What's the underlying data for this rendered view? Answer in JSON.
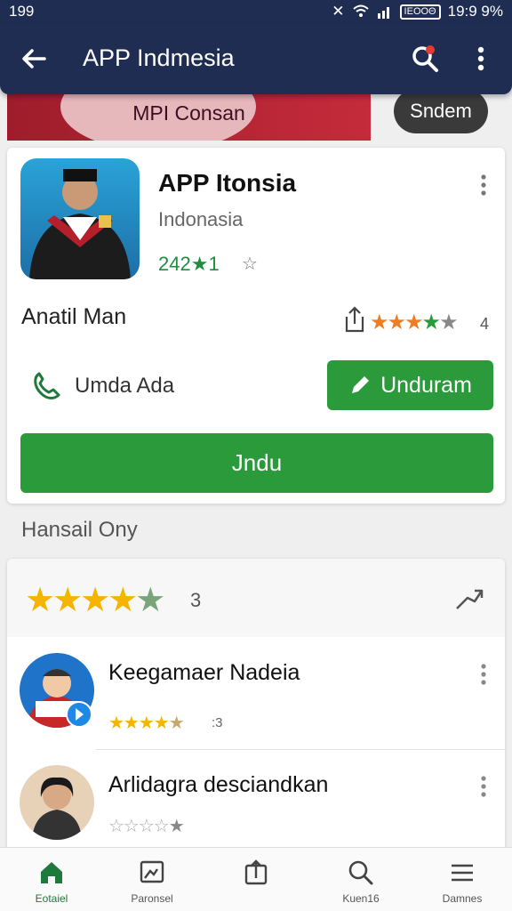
{
  "status": {
    "time_left": "199",
    "battery": "ΙΕΟΟΘ",
    "time_right": "19:9 9%"
  },
  "appbar": {
    "title": "APP Indmesia"
  },
  "banner": {
    "label": "MPI Consan"
  },
  "send_button": "Sndem",
  "app": {
    "title": "APP Itonsia",
    "subtitle": "Indonasia",
    "rating_text": "242",
    "rating_star_text": "★1",
    "developer": "Anatil Man",
    "stars_count": "4",
    "call_label": "Umda Ada",
    "secondary_button": "Unduram",
    "install_button": "Jndu"
  },
  "reviews_section": {
    "title": "Hansail Ony",
    "summary_count": "3",
    "items": [
      {
        "name": "Keegamaer Nadeia",
        "count": ":3"
      },
      {
        "name": "Arlidagra desciandkan",
        "count": ""
      }
    ]
  },
  "nav": [
    {
      "label": "Eotaiel",
      "icon": "home-icon"
    },
    {
      "label": "Paronsel",
      "icon": "gallery-icon"
    },
    {
      "label": "",
      "icon": "share-icon"
    },
    {
      "label": "Kuen16",
      "icon": "search-icon"
    },
    {
      "label": "Damnes",
      "icon": "menu-icon"
    }
  ],
  "colors": {
    "primary": "#1f2d52",
    "green": "#2a9a3a",
    "star_yellow": "#f5b400",
    "star_orange": "#ef7d22",
    "banner_red": "#c52b3a"
  }
}
